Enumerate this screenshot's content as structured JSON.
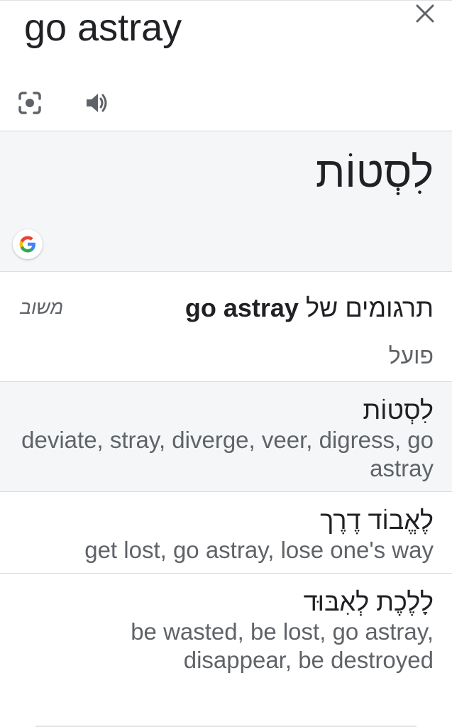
{
  "source": {
    "text": "go astray",
    "close_icon": "close-icon",
    "camera_icon": "camera-lens-icon",
    "speaker_icon": "speaker-icon"
  },
  "result": {
    "text": "לִסְטוֹת",
    "logo": "google-g-logo"
  },
  "translations": {
    "title_prefix": "תרגומים של",
    "title_term": "go astray",
    "frequency_label": "משוב",
    "part_of_speech": "פועל",
    "entries": [
      {
        "word": "לִסְטוֹת",
        "synonyms": "deviate, stray, diverge, veer, digress, go astray"
      },
      {
        "word": "לֶאֱבוֹד דֶרֶך",
        "synonyms": "get lost, go astray, lose one's way"
      },
      {
        "word": "לָלֶכֶת לְאִבּוּד",
        "synonyms": "be wasted, be lost, go astray, disappear, be destroyed"
      }
    ]
  },
  "colors": {
    "accent_text": "#202124",
    "secondary_text": "#5f6368",
    "panel_bg": "#f5f6f8"
  }
}
